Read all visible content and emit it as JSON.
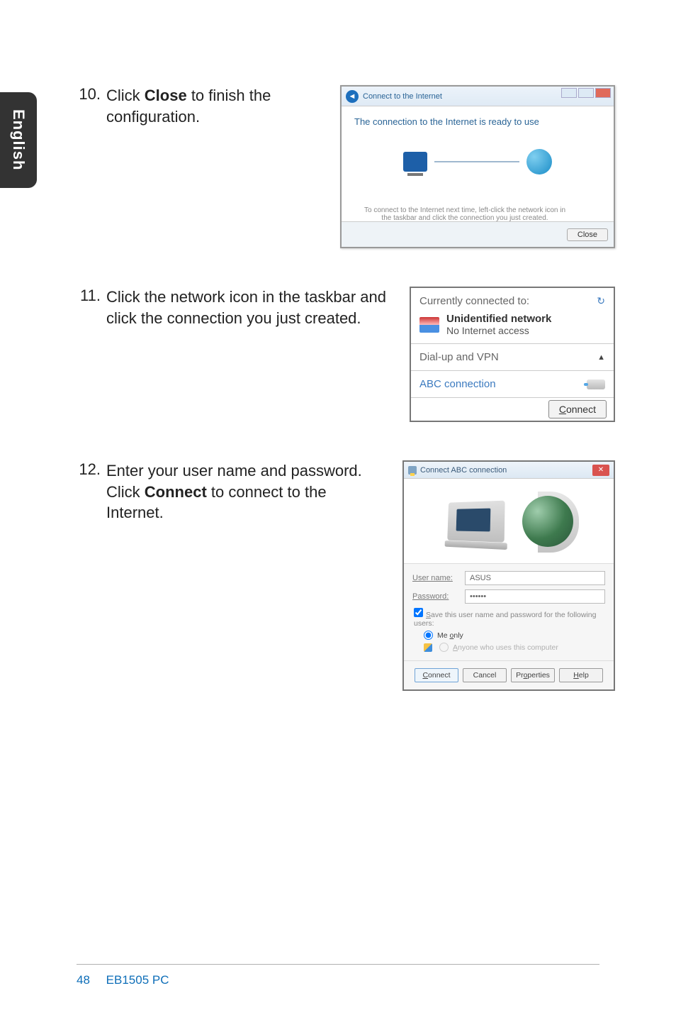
{
  "sideTab": "English",
  "steps": {
    "s10": {
      "num": "10.",
      "text_pre": "Click ",
      "bold": "Close",
      "text_post": " to finish the configuration."
    },
    "s11": {
      "num": "11.",
      "text": "Click the network icon in the taskbar and click the connection you just created."
    },
    "s12": {
      "num": "12.",
      "text_pre": "Enter your user name and password. Click ",
      "bold": "Connect",
      "text_post": " to connect to the Internet."
    }
  },
  "shot1": {
    "titlebar": "Connect to the Internet",
    "message": "The connection to the Internet is ready to use",
    "hint": "To connect to the Internet next time, left-click the network icon in the taskbar and click the connection you just created.",
    "closeBtn": "Close"
  },
  "shot2": {
    "header": "Currently connected to:",
    "netTitle": "Unidentified network",
    "netSub": "No Internet access",
    "section": "Dial-up and VPN",
    "connName": "ABC connection",
    "connectBtn": "Connect",
    "connectUnderline": "C"
  },
  "shot3": {
    "title": "Connect ABC connection",
    "userLabel": "User name:",
    "userUnderline": "U",
    "userValue": "ASUS",
    "passLabel": "Password:",
    "passUnderline": "P",
    "passValue": "••••••",
    "saveLabel": "Save this user name and password for the following users:",
    "saveUnderline": "S",
    "meOnly": "Me only",
    "meUnderline": "o",
    "anyone": "Anyone who uses this computer",
    "anyUnderline": "A",
    "btnConnect": "Connect",
    "btnConnectU": "C",
    "btnCancel": "Cancel",
    "btnProps": "Properties",
    "btnPropsU": "o",
    "btnHelp": "Help",
    "btnHelpU": "H"
  },
  "footer": {
    "pageNum": "48",
    "docName": "EB1505 PC"
  }
}
